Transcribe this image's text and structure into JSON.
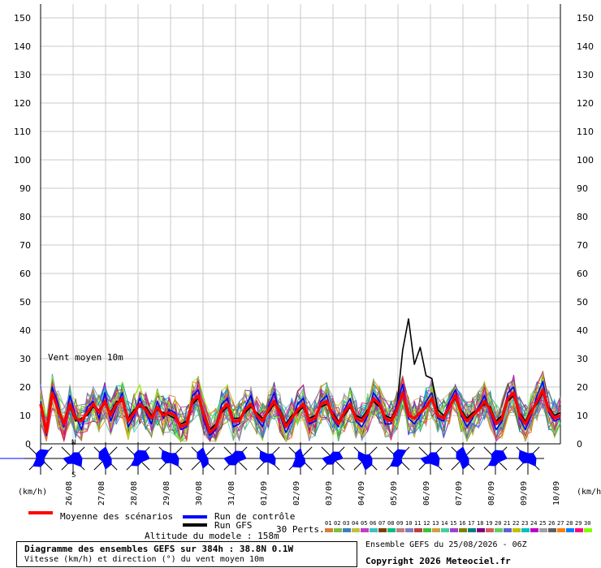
{
  "chart_data": {
    "type": "line",
    "ylim": [
      0,
      155
    ],
    "yticks": [
      0,
      10,
      20,
      30,
      40,
      50,
      60,
      70,
      80,
      90,
      100,
      110,
      120,
      130,
      140,
      150
    ],
    "yunit_left": "(km/h)",
    "yunit_right": "(km/h)",
    "inner_label": "Vent moyen 10m",
    "date_labels": [
      "26/08",
      "27/08",
      "28/08",
      "29/08",
      "30/08",
      "31/08",
      "01/09",
      "02/09",
      "03/09",
      "04/09",
      "05/09",
      "06/09",
      "07/09",
      "08/09",
      "09/09",
      "10/09"
    ],
    "x_step_hours": 6,
    "series": [
      {
        "name": "Moyenne des scénarios",
        "color": "#ff0000",
        "values": [
          14,
          4,
          18,
          12,
          7,
          14,
          9,
          8,
          11,
          14,
          11,
          15,
          10,
          14,
          16,
          8,
          11,
          14,
          12,
          9,
          13,
          10,
          11,
          10,
          6,
          7,
          15,
          17,
          10,
          4,
          6,
          12,
          14,
          8,
          8,
          12,
          14,
          10,
          8,
          12,
          15,
          11,
          6,
          9,
          12,
          14,
          8,
          9,
          14,
          15,
          10,
          7,
          11,
          14,
          9,
          8,
          11,
          16,
          14,
          9,
          8,
          12,
          18,
          10,
          9,
          11,
          13,
          16,
          10,
          9,
          13,
          17,
          11,
          8,
          10,
          12,
          15,
          12,
          7,
          9,
          16,
          18,
          10,
          7,
          11,
          15,
          19,
          12,
          9,
          10
        ],
        "style": "thick"
      },
      {
        "name": "Run de contrôle",
        "color": "#0000ff",
        "values": [
          15,
          3,
          20,
          14,
          6,
          17,
          10,
          5,
          13,
          15,
          9,
          18,
          8,
          13,
          18,
          6,
          10,
          16,
          11,
          7,
          15,
          9,
          12,
          11,
          5,
          6,
          17,
          19,
          8,
          3,
          5,
          14,
          16,
          6,
          7,
          13,
          17,
          9,
          6,
          13,
          18,
          10,
          4,
          8,
          14,
          16,
          7,
          8,
          15,
          17,
          9,
          6,
          12,
          16,
          8,
          6,
          10,
          18,
          15,
          7,
          7,
          14,
          21,
          9,
          7,
          10,
          15,
          18,
          9,
          8,
          15,
          19,
          10,
          6,
          9,
          13,
          17,
          11,
          5,
          8,
          18,
          20,
          9,
          5,
          10,
          17,
          22,
          11,
          8,
          9
        ],
        "style": "normal"
      },
      {
        "name": "Run GFS",
        "color": "#000000",
        "values": [
          14,
          5,
          19,
          11,
          8,
          13,
          8,
          9,
          10,
          13,
          12,
          14,
          11,
          15,
          15,
          9,
          12,
          13,
          13,
          10,
          12,
          11,
          10,
          9,
          7,
          8,
          14,
          16,
          11,
          5,
          7,
          11,
          13,
          9,
          9,
          11,
          13,
          11,
          9,
          11,
          14,
          12,
          7,
          10,
          11,
          13,
          9,
          10,
          13,
          14,
          11,
          8,
          10,
          13,
          10,
          9,
          12,
          15,
          13,
          10,
          9,
          13,
          33,
          44,
          28,
          34,
          24,
          23,
          12,
          10,
          13,
          16,
          12,
          9,
          11,
          12,
          14,
          13,
          8,
          10,
          15,
          17,
          11,
          8,
          12,
          14,
          18,
          13,
          10,
          11
        ],
        "style": "normal"
      }
    ],
    "wind_direction_labels": {
      "north": "N",
      "south": "S"
    },
    "legend": {
      "mean": "Moyenne des scénarios",
      "control": "Run de contrôle",
      "gfs": "Run GFS",
      "perts": "30 Perts.",
      "pert_numbers": [
        "01",
        "02",
        "03",
        "04",
        "05",
        "06",
        "07",
        "08",
        "09",
        "10",
        "11",
        "12",
        "13",
        "14",
        "15",
        "16",
        "17",
        "18",
        "19",
        "20",
        "21",
        "22",
        "23",
        "24",
        "25",
        "26",
        "27",
        "28",
        "29",
        "30"
      ],
      "pert_colors": [
        "#d5803a",
        "#7fbf3f",
        "#3f7fbf",
        "#bfbf3f",
        "#bf3fbf",
        "#3fbfbf",
        "#7f3f00",
        "#00bf7f",
        "#bf7f7f",
        "#7f7fbf",
        "#bf3f3f",
        "#3fbf3f",
        "#d0a040",
        "#40d0a0",
        "#a040d0",
        "#808000",
        "#008080",
        "#800080",
        "#d06060",
        "#60d060",
        "#6060d0",
        "#c0c000",
        "#00c0c0",
        "#c000c0",
        "#a0a0a0",
        "#606060",
        "#ff8000",
        "#0080ff",
        "#ff0080",
        "#80ff00"
      ]
    },
    "altitude": "Altitude du modele : 158m",
    "title": "Diagramme des ensembles GEFS sur 384h : 38.8N 0.1W",
    "subtitle": "Vitesse (km/h) et direction (°) du vent moyen 10m",
    "ensemble_run": "Ensemble GEFS du 25/08/2026 - 06Z",
    "copyright": "Copyright 2026 Meteociel.fr"
  }
}
